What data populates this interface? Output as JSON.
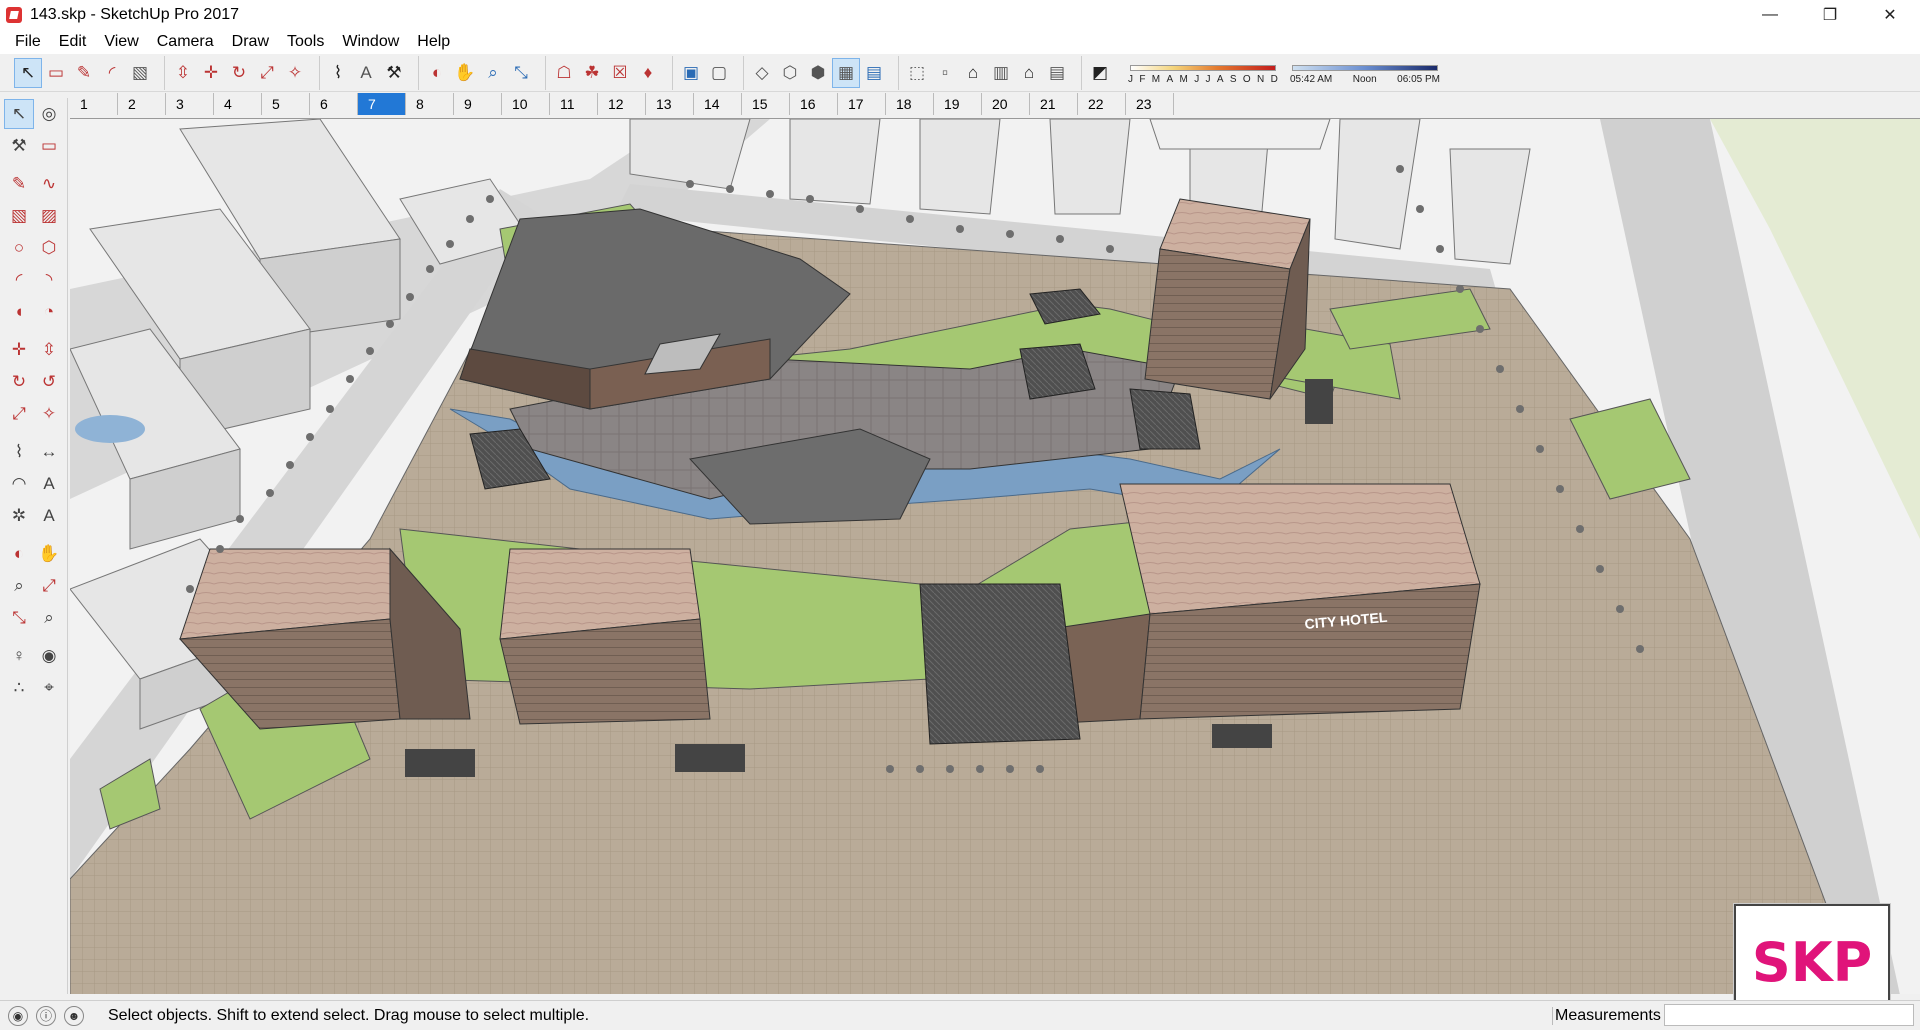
{
  "window": {
    "title": "143.skp - SketchUp Pro 2017",
    "controls": {
      "minimize": "—",
      "restore": "❐",
      "close": "✕"
    }
  },
  "menu": [
    "File",
    "Edit",
    "View",
    "Camera",
    "Draw",
    "Tools",
    "Window",
    "Help"
  ],
  "toolbar": {
    "groups": [
      [
        {
          "name": "select-icon",
          "glyph": "↖",
          "active": true,
          "tone": "dark"
        },
        {
          "name": "eraser-icon",
          "glyph": "▭"
        },
        {
          "name": "pencil-icon",
          "glyph": "✎"
        },
        {
          "name": "arc-icon",
          "glyph": "◜"
        },
        {
          "name": "rectangle-icon",
          "glyph": "▧",
          "tone": "gray"
        }
      ],
      [
        {
          "name": "push-pull-icon",
          "glyph": "⇳"
        },
        {
          "name": "move-icon",
          "glyph": "✛"
        },
        {
          "name": "rotate-icon",
          "glyph": "↻"
        },
        {
          "name": "scale-icon",
          "glyph": "⤢"
        },
        {
          "name": "offset-icon",
          "glyph": "✧"
        }
      ],
      [
        {
          "name": "tape-measure-icon",
          "glyph": "⌇",
          "tone": "dark"
        },
        {
          "name": "text-icon",
          "glyph": "A",
          "tone": "gray"
        },
        {
          "name": "paint-bucket-icon",
          "glyph": "⚒",
          "tone": "dark"
        }
      ],
      [
        {
          "name": "orbit-icon",
          "glyph": "◐"
        },
        {
          "name": "pan-icon",
          "glyph": "✋",
          "tone": "dark"
        },
        {
          "name": "zoom-icon",
          "glyph": "⌕",
          "tone": "blue"
        },
        {
          "name": "zoom-extents-icon",
          "glyph": "⤡",
          "tone": "blue"
        }
      ],
      [
        {
          "name": "warehouse-icon",
          "glyph": "☖"
        },
        {
          "name": "extension-warehouse-icon",
          "glyph": "☘"
        },
        {
          "name": "share-model-icon",
          "glyph": "☒"
        },
        {
          "name": "ruby-icon",
          "glyph": "♦"
        }
      ],
      [
        {
          "name": "xray-icon",
          "glyph": "▣",
          "tone": "blue"
        },
        {
          "name": "back-edges-icon",
          "glyph": "▢",
          "tone": "gray"
        }
      ],
      [
        {
          "name": "wireframe-icon",
          "glyph": "◇",
          "tone": "gray"
        },
        {
          "name": "hidden-line-icon",
          "glyph": "⬡",
          "tone": "gray"
        },
        {
          "name": "shaded-icon",
          "glyph": "⬢",
          "tone": "gray"
        },
        {
          "name": "shaded-textures-icon",
          "glyph": "▦",
          "active": true,
          "tone": "gray"
        },
        {
          "name": "monochrome-icon",
          "glyph": "▤",
          "tone": "blue"
        }
      ],
      [
        {
          "name": "iso-view-icon",
          "glyph": "⬚",
          "tone": "gray"
        },
        {
          "name": "top-view-icon",
          "glyph": "▫",
          "tone": "gray"
        },
        {
          "name": "front-view-icon",
          "glyph": "⌂",
          "tone": "dark"
        },
        {
          "name": "right-view-icon",
          "glyph": "▥",
          "tone": "gray"
        },
        {
          "name": "back-view-icon",
          "glyph": "⌂",
          "tone": "dark"
        },
        {
          "name": "left-view-icon",
          "glyph": "▤",
          "tone": "gray"
        }
      ],
      [
        {
          "name": "shadows-toggle-icon",
          "glyph": "◩",
          "tone": "dark"
        }
      ]
    ],
    "shadow_months": [
      "J",
      "F",
      "M",
      "A",
      "M",
      "J",
      "J",
      "A",
      "S",
      "O",
      "N",
      "D"
    ],
    "shadow_times": [
      "05:42 AM",
      "Noon",
      "06:05 PM"
    ]
  },
  "scenes": {
    "tabs": [
      "1",
      "2",
      "3",
      "4",
      "5",
      "6",
      "7",
      "8",
      "9",
      "10",
      "11",
      "12",
      "13",
      "14",
      "15",
      "16",
      "17",
      "18",
      "19",
      "20",
      "21",
      "22",
      "23"
    ],
    "active": "7"
  },
  "left_tools": [
    [
      {
        "name": "select-icon",
        "glyph": "↖",
        "active": true,
        "tone": "gray"
      },
      {
        "name": "component-icon",
        "glyph": "◎",
        "tone": "gray"
      }
    ],
    [
      {
        "name": "paint-bucket-icon",
        "glyph": "⚒",
        "tone": "gray"
      },
      {
        "name": "eraser-icon",
        "glyph": "▭"
      }
    ],
    "sep",
    [
      {
        "name": "line-icon",
        "glyph": "✎"
      },
      {
        "name": "freehand-icon",
        "glyph": "∿"
      }
    ],
    [
      {
        "name": "rectangle-icon",
        "glyph": "▧"
      },
      {
        "name": "rotated-rectangle-icon",
        "glyph": "▨"
      }
    ],
    [
      {
        "name": "circle-icon",
        "glyph": "○"
      },
      {
        "name": "polygon-icon",
        "glyph": "⬡"
      }
    ],
    [
      {
        "name": "arc-icon",
        "glyph": "◜"
      },
      {
        "name": "two-point-arc-icon",
        "glyph": "◝"
      }
    ],
    [
      {
        "name": "three-point-arc-icon",
        "glyph": "◖"
      },
      {
        "name": "pie-icon",
        "glyph": "◔"
      }
    ],
    "sep",
    [
      {
        "name": "move-icon",
        "glyph": "✛"
      },
      {
        "name": "push-pull-icon",
        "glyph": "⇳"
      }
    ],
    [
      {
        "name": "rotate-icon",
        "glyph": "↻"
      },
      {
        "name": "follow-me-icon",
        "glyph": "↺"
      }
    ],
    [
      {
        "name": "scale-icon",
        "glyph": "⤢"
      },
      {
        "name": "offset-icon",
        "glyph": "✧"
      }
    ],
    "sep",
    [
      {
        "name": "tape-measure-icon",
        "glyph": "⌇",
        "tone": "gray"
      },
      {
        "name": "dimension-icon",
        "glyph": "↔",
        "tone": "gray"
      }
    ],
    [
      {
        "name": "protractor-icon",
        "glyph": "◠",
        "tone": "gray"
      },
      {
        "name": "text-icon",
        "glyph": "A",
        "tone": "gray"
      }
    ],
    [
      {
        "name": "axes-icon",
        "glyph": "✲",
        "tone": "gray"
      },
      {
        "name": "3d-text-icon",
        "glyph": "A",
        "tone": "gray"
      }
    ],
    "sep",
    [
      {
        "name": "orbit-icon",
        "glyph": "◐"
      },
      {
        "name": "pan-icon",
        "glyph": "✋",
        "tone": "gray"
      }
    ],
    [
      {
        "name": "zoom-icon",
        "glyph": "⌕",
        "tone": "gray"
      },
      {
        "name": "zoom-window-icon",
        "glyph": "⤢"
      }
    ],
    [
      {
        "name": "zoom-extents-icon",
        "glyph": "⤡"
      },
      {
        "name": "previous-view-icon",
        "glyph": "⌕",
        "tone": "gray"
      }
    ],
    "sep",
    [
      {
        "name": "position-camera-icon",
        "glyph": "♀",
        "tone": "gray"
      },
      {
        "name": "look-around-icon",
        "glyph": "◉",
        "tone": "gray"
      }
    ],
    [
      {
        "name": "walk-icon",
        "glyph": "∴",
        "tone": "gray"
      },
      {
        "name": "section-plane-icon",
        "glyph": "⌖",
        "tone": "gray"
      }
    ]
  ],
  "status": {
    "message": "Select objects. Shift to extend select. Drag mouse to select multiple.",
    "measurements_label": "Measurements",
    "measurements_value": ""
  },
  "scene_signage": "CITY HOTEL",
  "watermark": "SKP",
  "colors": {
    "grass": "#a5c872",
    "plaza": "#b8aa97",
    "road": "#d5d5d5",
    "water": "#7a9fc4",
    "tower_roof": "#c9ab9a",
    "tower_wall": "#8a7466",
    "dark_roof": "#5a5a5a",
    "accent_active": "#2278d6"
  }
}
